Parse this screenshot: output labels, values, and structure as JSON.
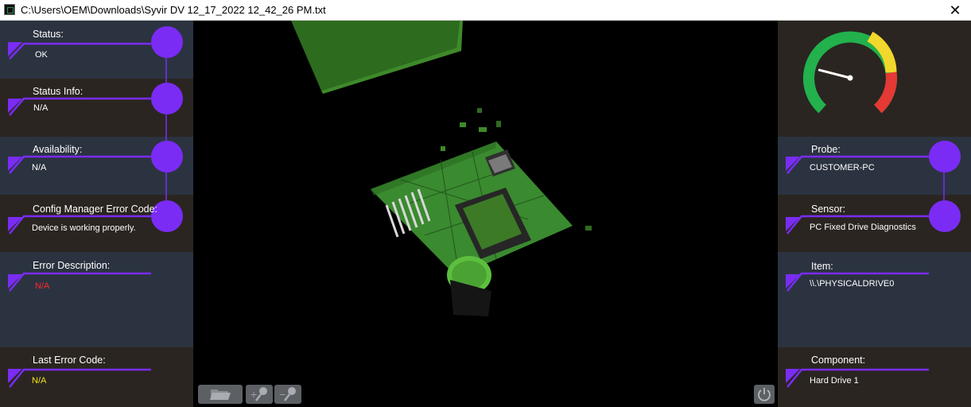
{
  "window": {
    "title": "C:\\Users\\OEM\\Downloads\\Syvir DV 12_17_2022 12_42_26 PM.txt",
    "close_glyph": "✕"
  },
  "accent_color": "#7a2cf5",
  "left_panel": [
    {
      "label": "Status:",
      "value": "OK",
      "value_color": "#ffffff"
    },
    {
      "label": "Status Info:",
      "value": "N/A",
      "value_color": "#ffffff"
    },
    {
      "label": "Availability:",
      "value": "N/A",
      "value_color": "#ffffff"
    },
    {
      "label": "Config Manager Error Code:",
      "value": "Device is working properly.",
      "value_color": "#ffffff"
    },
    {
      "label": "Error Description:",
      "value": "N/A",
      "value_color": "#ff2a2a"
    },
    {
      "label": "Last Error Code:",
      "value": "N/A",
      "value_color": "#f4e31a"
    }
  ],
  "right_panel": [
    {
      "label": "Probe:",
      "value": "CUSTOMER-PC"
    },
    {
      "label": "Sensor:",
      "value": "PC Fixed Drive Diagnostics"
    },
    {
      "label": "Item:",
      "value": "\\\\.\\PHYSICALDRIVE0"
    },
    {
      "label": "Component:",
      "value": "Hard Drive 1"
    }
  ],
  "gauge": {
    "level": 0.22,
    "colors": [
      "#22b14c",
      "#f2d72c",
      "#e53935"
    ]
  },
  "toolbar": {
    "icons": [
      "folder-open-icon",
      "zoom-in-icon",
      "zoom-out-icon",
      "power-icon"
    ],
    "zoom_in_glyph": "+",
    "zoom_out_glyph": "−"
  }
}
